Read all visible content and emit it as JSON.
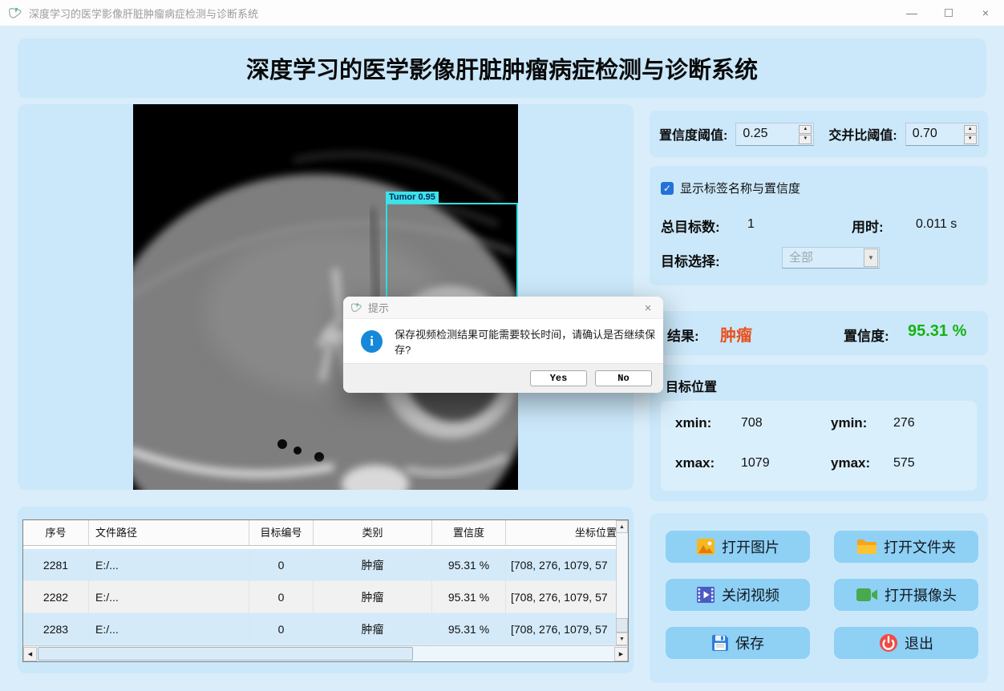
{
  "window": {
    "title": "深度学习的医学影像肝脏肿瘤病症检测与诊断系统",
    "minimize": "—",
    "maximize": "",
    "close": "×"
  },
  "header": {
    "title": "深度学习的医学影像肝脏肿瘤病症检测与诊断系统"
  },
  "viewer": {
    "detection_label": "Tumor 0.95"
  },
  "thresholds": {
    "conf_label": "置信度阈值:",
    "conf_value": "0.25",
    "iou_label": "交并比阈值:",
    "iou_value": "0.70"
  },
  "stats": {
    "show_labels": "显示标签名称与置信度",
    "total_label": "总目标数:",
    "total_value": "1",
    "time_label": "用时:",
    "time_value": "0.011 s",
    "select_label": "目标选择:",
    "select_value": "全部"
  },
  "result": {
    "label": "结果:",
    "value": "肿瘤",
    "conf_label": "置信度:",
    "conf_value": "95.31 %"
  },
  "position": {
    "title": "目标位置",
    "xmin_label": "xmin:",
    "xmin": "708",
    "ymin_label": "ymin:",
    "ymin": "276",
    "xmax_label": "xmax:",
    "xmax": "1079",
    "ymax_label": "ymax:",
    "ymax": "575"
  },
  "actions": {
    "open_image": "打开图片",
    "open_folder": "打开文件夹",
    "close_video": "关闭视频",
    "open_camera": "打开摄像头",
    "save": "保存",
    "exit": "退出"
  },
  "dialog": {
    "title": "提示",
    "info_glyph": "i",
    "message": "保存视频检测结果可能需要较长时间，请确认是否继续保存?",
    "yes": "Yes",
    "no": "No",
    "close": "×"
  },
  "table": {
    "headers": [
      "序号",
      "文件路径",
      "目标编号",
      "类别",
      "置信度",
      "坐标位置"
    ],
    "rows": [
      [
        "2281",
        "E:/...",
        "0",
        "肿瘤",
        "95.31 %",
        "[708, 276, 1079, 57"
      ],
      [
        "2282",
        "E:/...",
        "0",
        "肿瘤",
        "95.31 %",
        "[708, 276, 1079, 57"
      ],
      [
        "2283",
        "E:/...",
        "0",
        "肿瘤",
        "95.31 %",
        "[708, 276, 1079, 57"
      ]
    ]
  },
  "colors": {
    "panel": "#cbe8fa",
    "background": "#d9edfb",
    "button": "#8fd0f5",
    "tumor_text": "#e8501e",
    "confidence_green": "#14b314",
    "detection_cyan": "#2ee0e6",
    "checkbox_blue": "#2272d8"
  }
}
